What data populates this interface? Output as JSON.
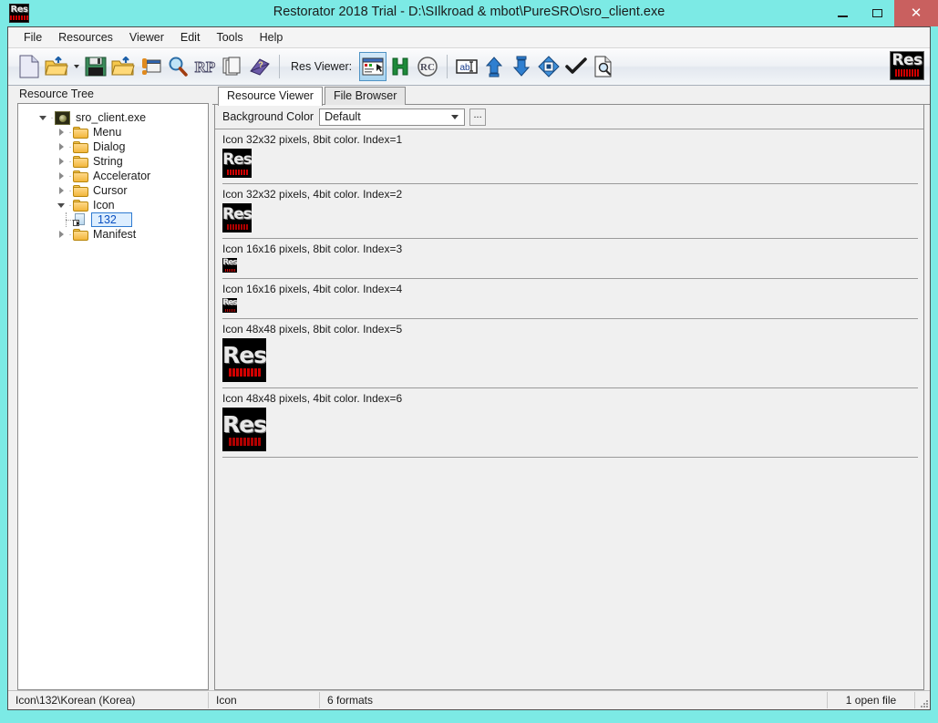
{
  "window": {
    "title": "Restorator 2018 Trial - D:\\SIlkroad & mbot\\PureSRO\\sro_client.exe",
    "app_icon_name": "res-logo-icon",
    "accent_color": "#7ceae5",
    "close_button_color": "#c9605f",
    "controls": {
      "minimize": "–",
      "maximize": "□",
      "close": "✕"
    }
  },
  "menubar": {
    "items": [
      {
        "label": "File"
      },
      {
        "label": "Resources"
      },
      {
        "label": "Viewer"
      },
      {
        "label": "Edit"
      },
      {
        "label": "Tools"
      },
      {
        "label": "Help"
      }
    ]
  },
  "toolbar": {
    "res_viewer_label": "Res Viewer:",
    "buttons": [
      {
        "name": "new-file-button",
        "icon": "new-document-icon"
      },
      {
        "name": "open-file-button",
        "icon": "open-folder-icon"
      },
      {
        "name": "open-file-dropdown",
        "icon": "chevron-down-icon"
      },
      {
        "name": "save-button",
        "icon": "floppy-disk-icon"
      },
      {
        "name": "open-folder-button",
        "icon": "open-folder-blue-arrow-icon"
      },
      {
        "name": "assign-button",
        "icon": "exclamation-window-icon"
      },
      {
        "name": "find-button",
        "icon": "magnifier-icon"
      },
      {
        "name": "resource-patch-button",
        "icon": "rp-icon"
      },
      {
        "name": "copy-button",
        "icon": "copy-pages-icon"
      },
      {
        "name": "help-button",
        "icon": "book-question-icon"
      }
    ],
    "viewer_buttons": [
      {
        "name": "res-viewer-preview-button",
        "icon": "preview-window-icon",
        "active": true
      },
      {
        "name": "res-viewer-hex-button",
        "icon": "hex-h-icon",
        "active": false
      },
      {
        "name": "res-viewer-rc-button",
        "icon": "rc-icon",
        "active": false
      },
      {
        "name": "res-viewer-text-button",
        "icon": "ab-text-icon",
        "active": false
      },
      {
        "name": "res-viewer-up-button",
        "icon": "arrow-up-icon",
        "active": false
      },
      {
        "name": "res-viewer-down-button",
        "icon": "arrow-down-icon",
        "active": false
      },
      {
        "name": "res-viewer-center-button",
        "icon": "diamond-target-icon",
        "active": false
      },
      {
        "name": "res-viewer-check-button",
        "icon": "checkmark-icon",
        "active": false
      },
      {
        "name": "res-viewer-print-preview-button",
        "icon": "page-magnifier-icon",
        "active": false
      }
    ]
  },
  "left_panel": {
    "header": "Resource Tree",
    "tree": [
      {
        "label": "sro_client.exe",
        "level": 0,
        "icon": "exe-icon",
        "expander": "open",
        "selected": false
      },
      {
        "label": "Menu",
        "level": 1,
        "icon": "folder-icon",
        "expander": "closed",
        "selected": false
      },
      {
        "label": "Dialog",
        "level": 1,
        "icon": "folder-icon",
        "expander": "closed",
        "selected": false
      },
      {
        "label": "String",
        "level": 1,
        "icon": "folder-icon",
        "expander": "closed",
        "selected": false
      },
      {
        "label": "Accelerator",
        "level": 1,
        "icon": "folder-icon",
        "expander": "closed",
        "selected": false
      },
      {
        "label": "Cursor",
        "level": 1,
        "icon": "folder-icon",
        "expander": "closed",
        "selected": false
      },
      {
        "label": "Icon",
        "level": 1,
        "icon": "folder-icon",
        "expander": "open",
        "selected": false
      },
      {
        "label": "132",
        "level": 2,
        "icon": "resource-item-icon",
        "expander": "none",
        "selected": true
      },
      {
        "label": "Manifest",
        "level": 1,
        "icon": "folder-icon",
        "expander": "closed",
        "selected": false
      }
    ]
  },
  "right_panel": {
    "tabs": [
      {
        "label": "Resource Viewer",
        "active": true
      },
      {
        "label": "File Browser",
        "active": false
      }
    ],
    "background_color": {
      "label": "Background Color",
      "value": "Default",
      "options": [
        "Default"
      ],
      "ellipsis_label": "..."
    },
    "icon_entries": [
      {
        "caption": "Icon 32x32 pixels, 8bit color. Index=1",
        "size": 32,
        "depth": "8bit"
      },
      {
        "caption": "Icon 32x32 pixels, 4bit color. Index=2",
        "size": 32,
        "depth": "4bit"
      },
      {
        "caption": "Icon 16x16 pixels, 8bit color. Index=3",
        "size": 16,
        "depth": "8bit"
      },
      {
        "caption": "Icon 16x16 pixels, 4bit color. Index=4",
        "size": 16,
        "depth": "4bit"
      },
      {
        "caption": "Icon 48x48 pixels, 8bit color. Index=5",
        "size": 48,
        "depth": "8bit"
      },
      {
        "caption": "Icon 48x48 pixels, 4bit color. Index=6",
        "size": 48,
        "depth": "4bit"
      }
    ]
  },
  "statusbar": {
    "path": "Icon\\132\\Korean (Korea)",
    "type": "Icon",
    "formats": "6 formats",
    "open_files": "1 open file"
  },
  "res_logo": {
    "text": "Res"
  }
}
